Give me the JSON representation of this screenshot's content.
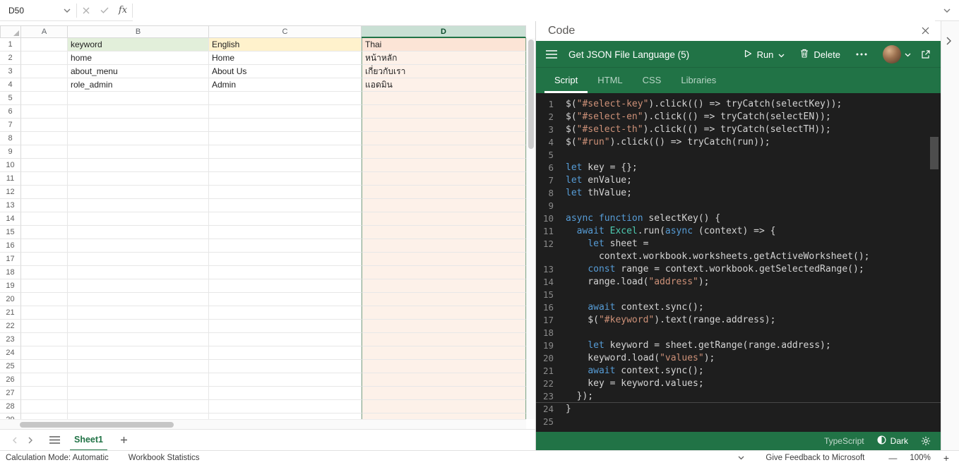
{
  "colors": {
    "accent": "#217346",
    "editor_bg": "#1e1e1e",
    "string": "#ce9178",
    "keyword": "#569cd6"
  },
  "formula_bar": {
    "name_box": "D50",
    "fx": "fx",
    "formula": ""
  },
  "sheet": {
    "columns": [
      "A",
      "B",
      "C",
      "D"
    ],
    "selected_column": "D",
    "visible_rows": 29,
    "cells": [
      {
        "row": 1,
        "col": "B",
        "text": "keyword",
        "fill": "#e2efda"
      },
      {
        "row": 1,
        "col": "C",
        "text": "English",
        "fill": "#fff2cc"
      },
      {
        "row": 1,
        "col": "D",
        "text": "Thai",
        "fill": "#fce4d6"
      },
      {
        "row": 2,
        "col": "B",
        "text": "home"
      },
      {
        "row": 2,
        "col": "C",
        "text": "Home"
      },
      {
        "row": 2,
        "col": "D",
        "text": "หน้าหลัก"
      },
      {
        "row": 3,
        "col": "B",
        "text": "about_menu"
      },
      {
        "row": 3,
        "col": "C",
        "text": "About Us"
      },
      {
        "row": 3,
        "col": "D",
        "text": "เกี่ยวกับเรา"
      },
      {
        "row": 4,
        "col": "B",
        "text": "role_admin"
      },
      {
        "row": 4,
        "col": "C",
        "text": "Admin"
      },
      {
        "row": 4,
        "col": "D",
        "text": "แอดมิน"
      }
    ]
  },
  "sheet_tabs": {
    "active": "Sheet1"
  },
  "status_bar": {
    "calc": "Calculation Mode: Automatic",
    "stats": "Workbook Statistics",
    "feedback": "Give Feedback to Microsoft",
    "zoom_out": "—",
    "zoom": "100%",
    "zoom_in": "+"
  },
  "code_pane": {
    "title": "Code",
    "snippet": "Get JSON File Language (5)",
    "run": "Run",
    "delete": "Delete",
    "tabs": [
      "Script",
      "HTML",
      "CSS",
      "Libraries"
    ],
    "active_tab": "Script",
    "language": "TypeScript",
    "theme": "Dark",
    "lines": [
      {
        "n": "1",
        "c": "$(\"#select-key\").click(() => tryCatch(selectKey));"
      },
      {
        "n": "2",
        "c": "$(\"#select-en\").click(() => tryCatch(selectEN));"
      },
      {
        "n": "3",
        "c": "$(\"#select-th\").click(() => tryCatch(selectTH));"
      },
      {
        "n": "4",
        "c": "$(\"#run\").click(() => tryCatch(run));"
      },
      {
        "n": "5",
        "c": ""
      },
      {
        "n": "6",
        "c": "let key = {};"
      },
      {
        "n": "7",
        "c": "let enValue;"
      },
      {
        "n": "8",
        "c": "let thValue;"
      },
      {
        "n": "9",
        "c": ""
      },
      {
        "n": "10",
        "c": "async function selectKey() {"
      },
      {
        "n": "11",
        "c": "  await Excel.run(async (context) => {"
      },
      {
        "n": "12",
        "c": "    let sheet ="
      },
      {
        "n": "",
        "c": "      context.workbook.worksheets.getActiveWorksheet();"
      },
      {
        "n": "13",
        "c": "    const range = context.workbook.getSelectedRange();"
      },
      {
        "n": "14",
        "c": "    range.load(\"address\");"
      },
      {
        "n": "15",
        "c": ""
      },
      {
        "n": "16",
        "c": "    await context.sync();"
      },
      {
        "n": "17",
        "c": "    $(\"#keyword\").text(range.address);"
      },
      {
        "n": "18",
        "c": ""
      },
      {
        "n": "19",
        "c": "    let keyword = sheet.getRange(range.address);"
      },
      {
        "n": "20",
        "c": "    keyword.load(\"values\");"
      },
      {
        "n": "21",
        "c": "    await context.sync();"
      },
      {
        "n": "22",
        "c": "    key = keyword.values;"
      },
      {
        "n": "23",
        "c": "  });",
        "rule": true
      },
      {
        "n": "24",
        "c": "}"
      },
      {
        "n": "25",
        "c": ""
      }
    ]
  }
}
